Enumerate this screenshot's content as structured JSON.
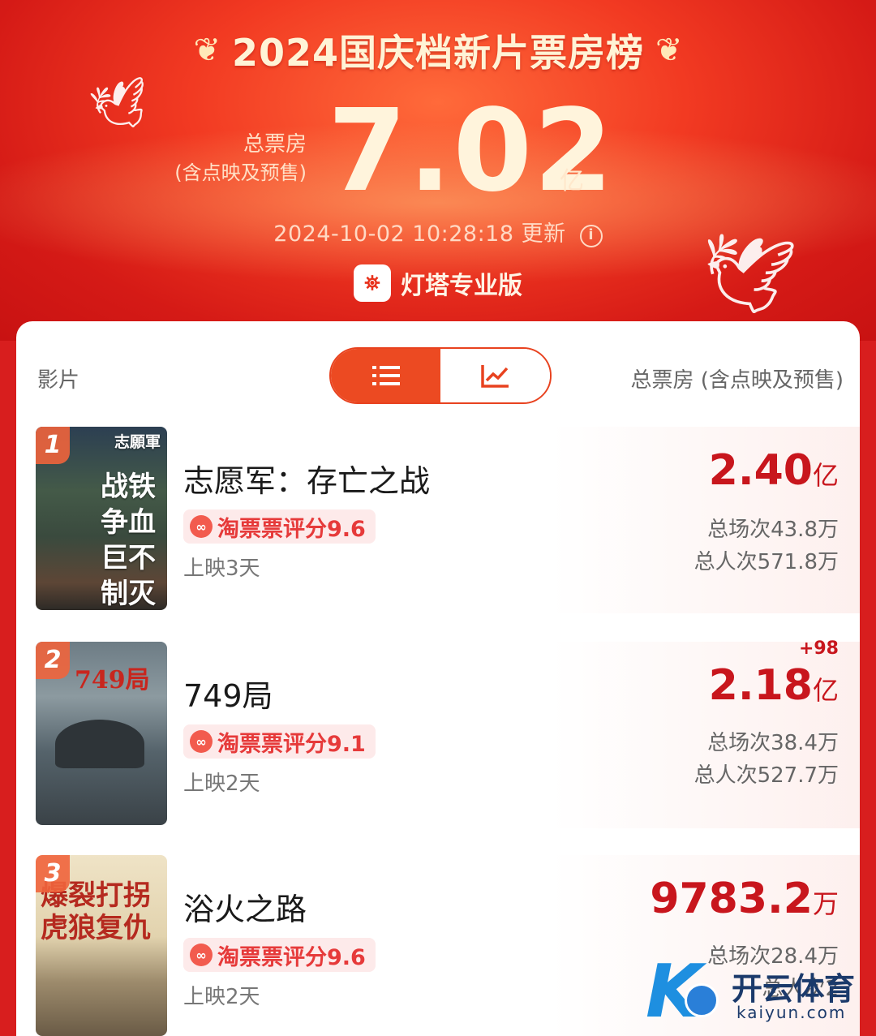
{
  "header": {
    "title": "2024国庆档新片票房榜",
    "total_label": "总票房",
    "total_sub": "(含点映及预售)",
    "total_value": "7.02",
    "total_unit": "亿",
    "update_time": "2024-10-02 10:28:18 更新",
    "info_icon": "ⓘ",
    "brand_name": "灯塔专业版",
    "brand_icon": "lighthouse-icon"
  },
  "table": {
    "col_film": "影片",
    "col_box": "总票房 (含点映及预售)",
    "toggle_list": "☰",
    "toggle_chart": "📈"
  },
  "films": [
    {
      "rank": "1",
      "name": "志愿军：存亡之战",
      "rating": "淘票票评分9.6",
      "days": "上映3天",
      "box_value": "2.40",
      "box_unit": "亿",
      "delta": "",
      "screenings": "总场次43.8万",
      "admissions": "总人次571.8万",
      "poster_title": "志願軍",
      "poster_lines": [
        "战铁",
        "争血",
        "巨不",
        "制灭"
      ]
    },
    {
      "rank": "2",
      "name": "749局",
      "rating": "淘票票评分9.1",
      "days": "上映2天",
      "box_value": "2.18",
      "box_unit": "亿",
      "delta": "+98",
      "screenings": "总场次38.4万",
      "admissions": "总人次527.7万",
      "poster_title": "749局",
      "poster_lines": []
    },
    {
      "rank": "3",
      "name": "浴火之路",
      "rating": "淘票票评分9.6",
      "days": "上映2天",
      "box_value": "9783.2",
      "box_unit": "万",
      "delta": "",
      "screenings": "总场次28.4万",
      "admissions": "总人次2",
      "poster_title": "爆裂打拐",
      "poster_lines": [
        "虎狼复仇"
      ]
    }
  ],
  "watermark": {
    "name_cn": "开云体育",
    "name_en": "kaiyun.com"
  },
  "colors": {
    "header_red": "#d51a16",
    "accent": "#ec4a22",
    "box_red": "#c8161d"
  }
}
